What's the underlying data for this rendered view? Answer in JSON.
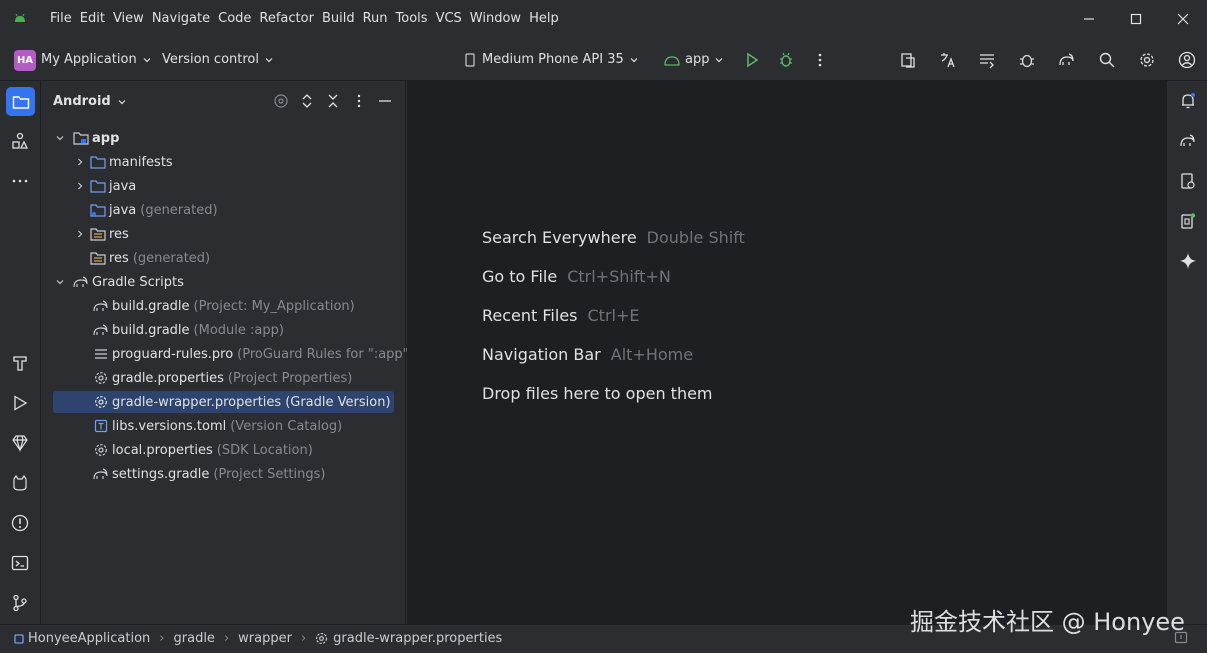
{
  "menu": [
    "File",
    "Edit",
    "View",
    "Navigate",
    "Code",
    "Refactor",
    "Build",
    "Run",
    "Tools",
    "VCS",
    "Window",
    "Help"
  ],
  "toolbar": {
    "project_badge": "HA",
    "project_name": "My Application",
    "version_control": "Version control",
    "device": "Medium Phone API 35",
    "run_config": "app"
  },
  "project_panel": {
    "title": "Android",
    "tree": [
      {
        "label": "app",
        "hint": "",
        "bold": true
      },
      {
        "label": "manifests",
        "hint": ""
      },
      {
        "label": "java",
        "hint": ""
      },
      {
        "label": "java",
        "hint": "(generated)"
      },
      {
        "label": "res",
        "hint": ""
      },
      {
        "label": "res",
        "hint": "(generated)"
      },
      {
        "label": "Gradle Scripts",
        "hint": ""
      },
      {
        "label": "build.gradle",
        "hint": "(Project: My_Application)"
      },
      {
        "label": "build.gradle",
        "hint": "(Module :app)"
      },
      {
        "label": "proguard-rules.pro",
        "hint": "(ProGuard Rules for \":app\")"
      },
      {
        "label": "gradle.properties",
        "hint": "(Project Properties)"
      },
      {
        "label": "gradle-wrapper.properties",
        "hint": "(Gradle Version)"
      },
      {
        "label": "libs.versions.toml",
        "hint": "(Version Catalog)"
      },
      {
        "label": "local.properties",
        "hint": "(SDK Location)"
      },
      {
        "label": "settings.gradle",
        "hint": "(Project Settings)"
      }
    ]
  },
  "editor": {
    "actions": [
      {
        "label": "Search Everywhere",
        "shortcut": "Double Shift"
      },
      {
        "label": "Go to File",
        "shortcut": "Ctrl+Shift+N"
      },
      {
        "label": "Recent Files",
        "shortcut": "Ctrl+E"
      },
      {
        "label": "Navigation Bar",
        "shortcut": "Alt+Home"
      },
      {
        "label": "Drop files here to open them",
        "shortcut": ""
      }
    ]
  },
  "statusbar": {
    "breadcrumbs": [
      "HonyeeApplication",
      "gradle",
      "wrapper",
      "gradle-wrapper.properties"
    ]
  },
  "watermark": "掘金技术社区 @ Honyee",
  "colors": {
    "accent": "#3574f0",
    "selection": "#2e436e",
    "run_green": "#5fb865",
    "badge": "#b25cc4"
  }
}
